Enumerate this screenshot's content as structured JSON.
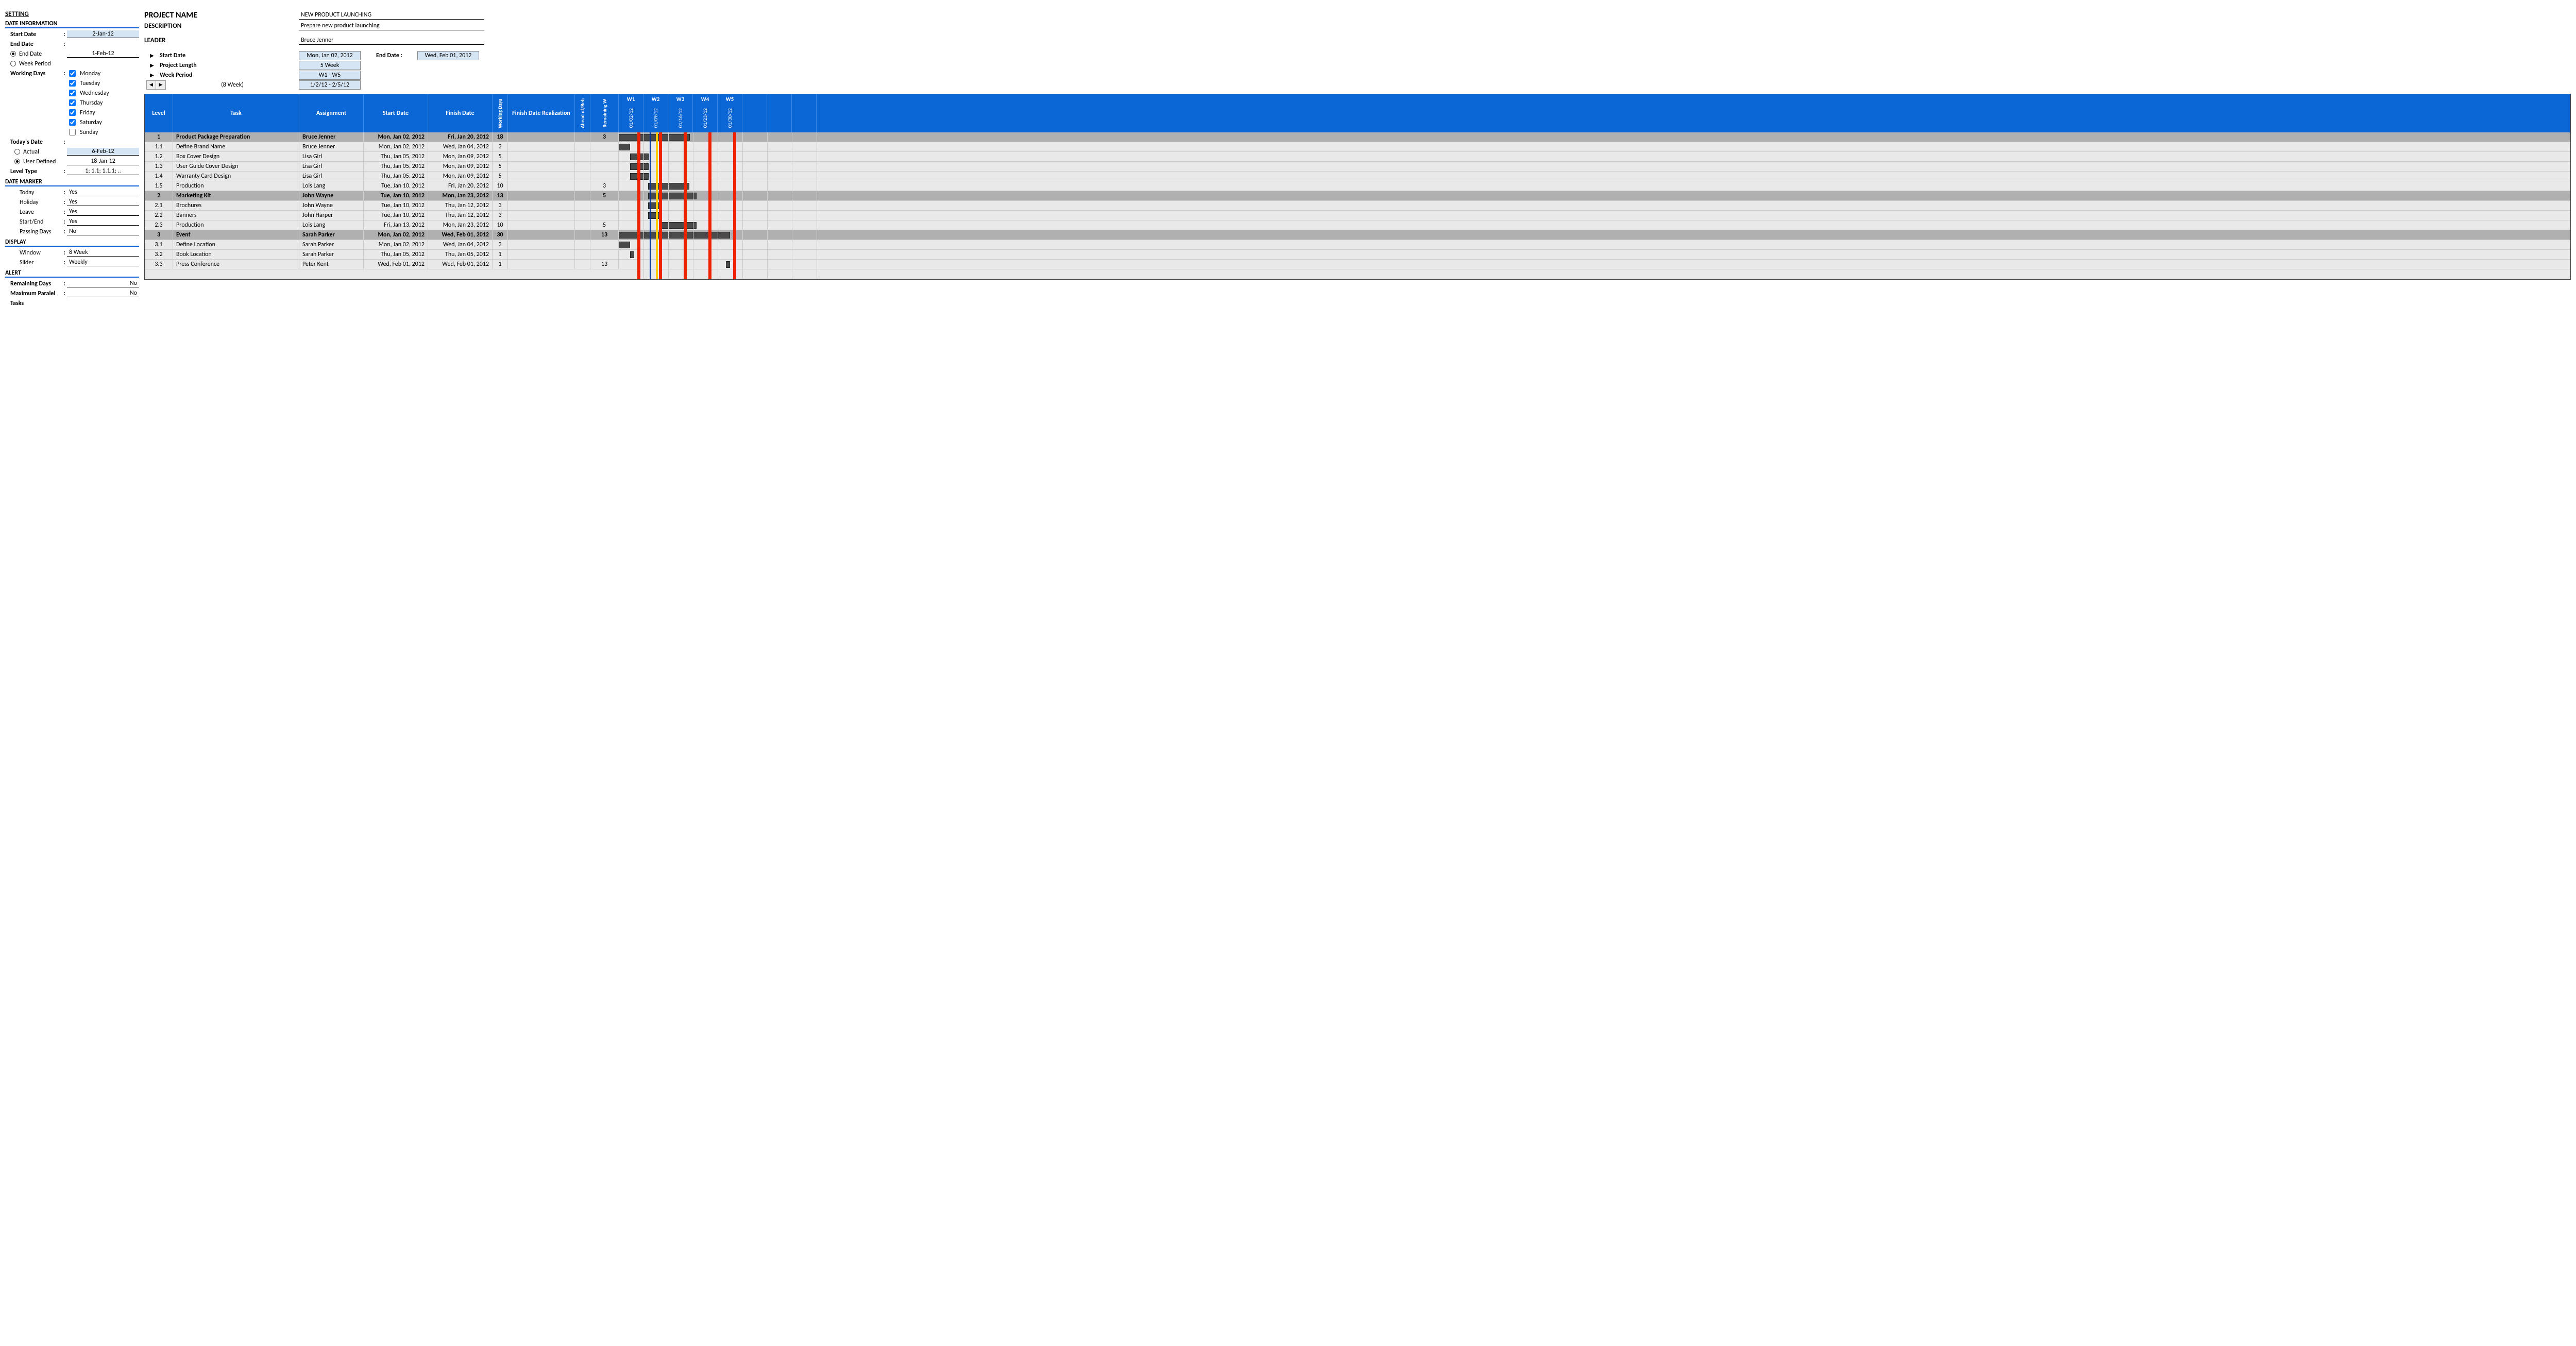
{
  "setting": {
    "title": "SETTING",
    "date_info_title": "DATE INFORMATION",
    "start_date_lbl": "Start Date",
    "start_date": "2-Jan-12",
    "end_date_lbl": "End Date",
    "end_date_radio": "End Date",
    "end_date_val": "1-Feb-12",
    "week_period_radio": "Week Period",
    "working_days_lbl": "Working Days",
    "days": [
      {
        "name": "Monday",
        "checked": true
      },
      {
        "name": "Tuesday",
        "checked": true
      },
      {
        "name": "Wednesday",
        "checked": true
      },
      {
        "name": "Thursday",
        "checked": true
      },
      {
        "name": "Friday",
        "checked": true
      },
      {
        "name": "Saturday",
        "checked": true
      },
      {
        "name": "Sunday",
        "checked": false
      }
    ],
    "todays_date_lbl": "Today's Date",
    "actual_radio": "Actual",
    "actual_val": "6-Feb-12",
    "user_def_radio": "User Defined",
    "user_def_val": "18-Jan-12",
    "level_type_lbl": "Level Type",
    "level_type_val": "1; 1.1; 1.1.1; ..",
    "date_marker_title": "DATE MARKER",
    "today_lbl": "Today",
    "today_val": "Yes",
    "holiday_lbl": "Holiday",
    "holiday_val": "Yes",
    "leave_lbl": "Leave",
    "leave_val": "Yes",
    "startend_lbl": "Start/End",
    "startend_val": "Yes",
    "passing_lbl": "Passing Days",
    "passing_val": "No",
    "display_title": "DISPLAY",
    "window_lbl": "Window",
    "window_val": "8 Week",
    "slider_lbl": "Slider",
    "slider_val": "Weekly",
    "alert_title": "ALERT",
    "remain_lbl": "Remaining Days",
    "remain_val": "No",
    "max_lbl": "Maximum Paralel",
    "max_val": "No",
    "tasks_lbl": "Tasks"
  },
  "project": {
    "name_lbl": "PROJECT NAME",
    "name": "NEW PRODUCT LAUNCHING",
    "desc_lbl": "DESCRIPTION",
    "desc": "Prepare new product launching",
    "leader_lbl": "LEADER",
    "leader": "Bruce Jenner",
    "sd_lbl": "Start Date",
    "sd": "Mon, Jan 02, 2012",
    "len_lbl": "Project Length",
    "len": "5 Week",
    "wp_lbl": "Week Period",
    "wp": "W1 - W5",
    "slide_lbl": "(8 Week)",
    "slide_range": "1/2/12 - 2/5/12",
    "ed_lbl": "End Date :",
    "ed": "Wed, Feb 01, 2012"
  },
  "columns": {
    "level": "Level",
    "task": "Task",
    "assign": "Assignment",
    "sd": "Start Date",
    "fd": "Finish Date",
    "wd": "Working Days",
    "fdr": "Finish Date Realization",
    "ab": "Ahead of/Beh",
    "rw": "Remaining W"
  },
  "weeks": [
    {
      "w": "W1",
      "d": "01/02/12"
    },
    {
      "w": "W2",
      "d": "01/09/12"
    },
    {
      "w": "W3",
      "d": "01/16/12"
    },
    {
      "w": "W4",
      "d": "01/23/12"
    },
    {
      "w": "W5",
      "d": "01/30/12"
    },
    {
      "w": "",
      "d": ""
    },
    {
      "w": "",
      "d": ""
    },
    {
      "w": "",
      "d": ""
    }
  ],
  "rows": [
    {
      "level": "1",
      "task": "Product Package Preparation",
      "assign": "Bruce Jenner",
      "sd": "Mon, Jan 02, 2012",
      "fd": "Fri, Jan 20, 2012",
      "wd": "18",
      "rw": "3",
      "parent": true,
      "bar": [
        0,
        138
      ]
    },
    {
      "level": "1.1",
      "task": "Define Brand Name",
      "assign": "Bruce Jenner",
      "sd": "Mon, Jan 02, 2012",
      "fd": "Wed, Jan 04, 2012",
      "wd": "3",
      "rw": "",
      "parent": false,
      "bar": [
        0,
        22
      ]
    },
    {
      "level": "1.2",
      "task": "Box Cover Design",
      "assign": "Lisa Girl",
      "sd": "Thu, Jan 05, 2012",
      "fd": "Mon, Jan 09, 2012",
      "wd": "5",
      "rw": "",
      "parent": false,
      "bar": [
        22,
        36
      ]
    },
    {
      "level": "1.3",
      "task": "User Guide Cover Design",
      "assign": "Lisa Girl",
      "sd": "Thu, Jan 05, 2012",
      "fd": "Mon, Jan 09, 2012",
      "wd": "5",
      "rw": "",
      "parent": false,
      "bar": [
        22,
        36
      ]
    },
    {
      "level": "1.4",
      "task": "Warranty Card Design",
      "assign": "Lisa Girl",
      "sd": "Thu, Jan 05, 2012",
      "fd": "Mon, Jan 09, 2012",
      "wd": "5",
      "rw": "",
      "parent": false,
      "bar": [
        22,
        36
      ]
    },
    {
      "level": "1.5",
      "task": "Production",
      "assign": "Lois Lang",
      "sd": "Tue, Jan 10, 2012",
      "fd": "Fri, Jan 20, 2012",
      "wd": "10",
      "rw": "3",
      "parent": false,
      "bar": [
        57,
        80
      ]
    },
    {
      "level": "2",
      "task": "Marketing Kit",
      "assign": "John Wayne",
      "sd": "Tue, Jan 10, 2012",
      "fd": "Mon, Jan 23, 2012",
      "wd": "13",
      "rw": "5",
      "parent": true,
      "bar": [
        57,
        94
      ]
    },
    {
      "level": "2.1",
      "task": "Brochures",
      "assign": "John Wayne",
      "sd": "Tue, Jan 10, 2012",
      "fd": "Thu, Jan 12, 2012",
      "wd": "3",
      "rw": "",
      "parent": false,
      "bar": [
        57,
        22
      ]
    },
    {
      "level": "2.2",
      "task": "Banners",
      "assign": "John Harper",
      "sd": "Tue, Jan 10, 2012",
      "fd": "Thu, Jan 12, 2012",
      "wd": "3",
      "rw": "",
      "parent": false,
      "bar": [
        57,
        22
      ]
    },
    {
      "level": "2.3",
      "task": "Production",
      "assign": "Lois Lang",
      "sd": "Fri, Jan 13, 2012",
      "fd": "Mon, Jan 23, 2012",
      "wd": "10",
      "rw": "5",
      "parent": false,
      "bar": [
        79,
        72
      ]
    },
    {
      "level": "3",
      "task": "Event",
      "assign": "Sarah Parker",
      "sd": "Mon, Jan 02, 2012",
      "fd": "Wed, Feb 01, 2012",
      "wd": "30",
      "rw": "13",
      "parent": true,
      "bar": [
        0,
        216
      ]
    },
    {
      "level": "3.1",
      "task": "Define Location",
      "assign": "Sarah Parker",
      "sd": "Mon, Jan 02, 2012",
      "fd": "Wed, Jan 04, 2012",
      "wd": "3",
      "rw": "",
      "parent": false,
      "bar": [
        0,
        22
      ]
    },
    {
      "level": "3.2",
      "task": "Book Location",
      "assign": "Sarah Parker",
      "sd": "Thu, Jan 05, 2012",
      "fd": "Thu, Jan 05, 2012",
      "wd": "1",
      "rw": "",
      "parent": false,
      "bar": [
        22,
        8
      ]
    },
    {
      "level": "3.3",
      "task": "Press Conference",
      "assign": "Peter Kent",
      "sd": "Wed, Feb 01, 2012",
      "fd": "Wed, Feb 01, 2012",
      "wd": "1",
      "rw": "13",
      "parent": false,
      "bar": [
        208,
        8
      ]
    }
  ],
  "markers": {
    "red_lines": [
      36,
      78,
      126,
      174,
      222
    ],
    "blue_line": 60,
    "yellow_line": 72
  }
}
